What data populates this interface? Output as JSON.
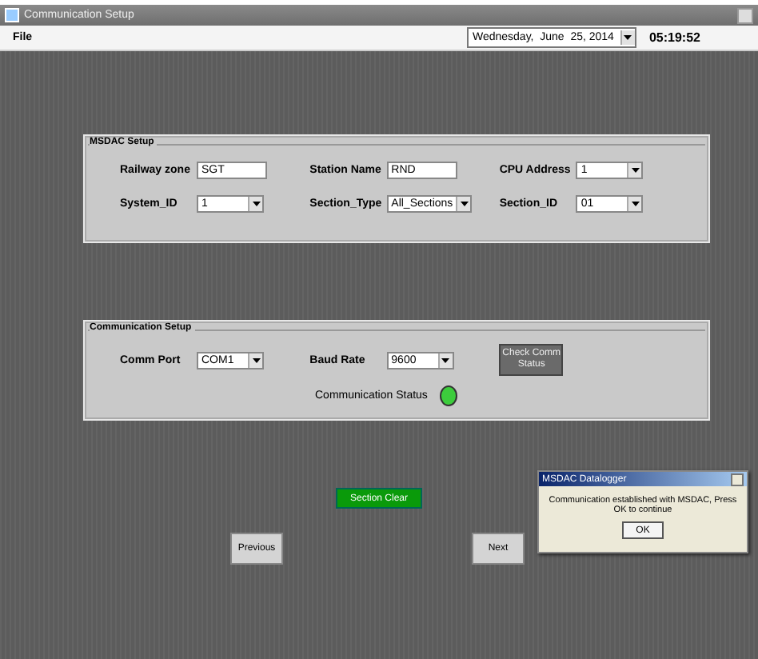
{
  "window": {
    "title": "Communication Setup"
  },
  "menu": [
    "File"
  ],
  "date_picker": {
    "value": "Wednesday,  June  25, 2014"
  },
  "clock": "05:19:52",
  "msdac_setup": {
    "title": "MSDAC Setup",
    "fields": [
      {
        "label": "Railway zone",
        "kind": "text",
        "value": "SGT"
      },
      {
        "label": "Station Name",
        "kind": "text",
        "value": "RND"
      },
      {
        "label": "CPU Address",
        "kind": "combo",
        "value": "1"
      },
      {
        "label": "System_ID",
        "kind": "combo",
        "value": "1"
      },
      {
        "label": "Section_Type",
        "kind": "combo",
        "value": "All_Sections"
      },
      {
        "label": "Section_ID",
        "kind": "combo",
        "value": "01"
      }
    ]
  },
  "communication_setup": {
    "title": "Communication Setup",
    "fields": [
      {
        "label": "Comm Port",
        "kind": "combo",
        "value": "COM1"
      },
      {
        "label": "Baud Rate",
        "kind": "combo",
        "value": "9600"
      }
    ],
    "check_button": "Check Comm Status",
    "status_label": "Communication Status",
    "status_on": true
  },
  "section_clear_button": "Section Clear",
  "previous_button": "Previous",
  "next_button": "Next",
  "dialog": {
    "title": "MSDAC Datalogger",
    "message": "Communication established with MSDAC, Press OK to continue",
    "ok_button": "OK"
  }
}
